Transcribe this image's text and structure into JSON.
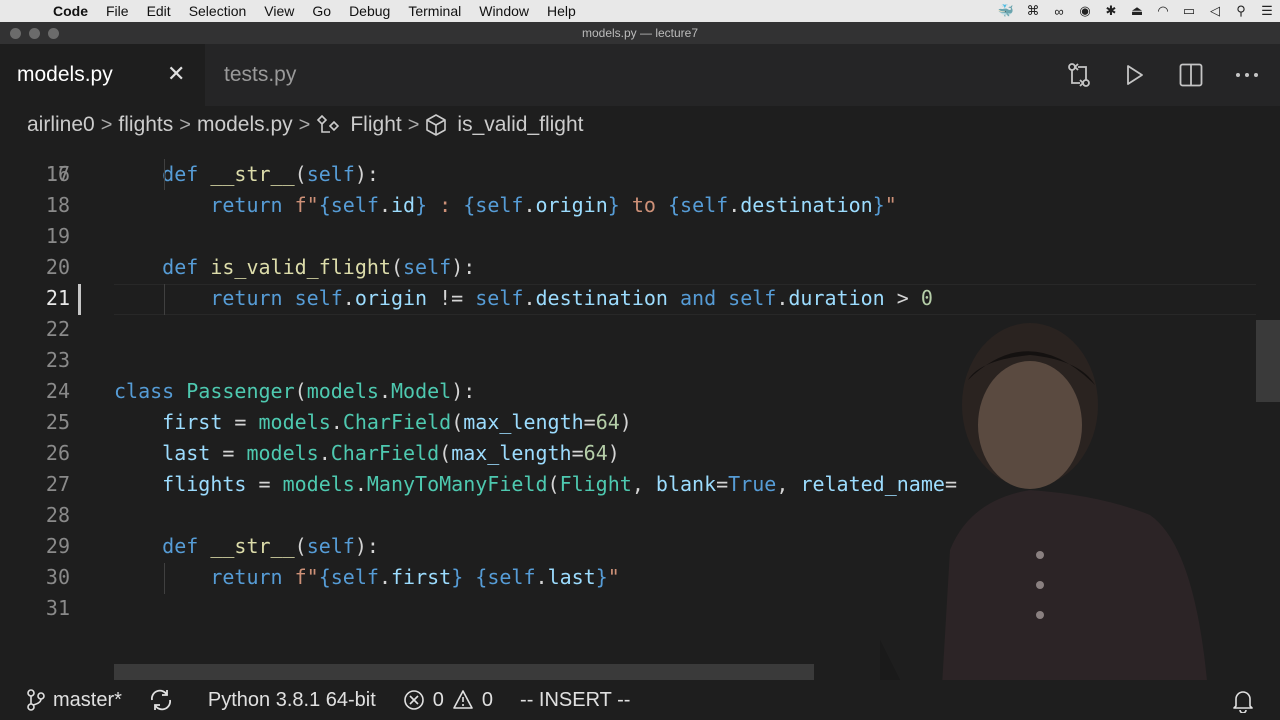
{
  "menubar": {
    "apple_icon": "apple-logo-icon",
    "items": [
      "Code",
      "File",
      "Edit",
      "Selection",
      "View",
      "Go",
      "Debug",
      "Terminal",
      "Window",
      "Help"
    ],
    "tray_icons": [
      "docker-icon",
      "command-icon",
      "glasses-icon",
      "media-icon",
      "bluetooth-icon",
      "eject-icon",
      "wifi-icon",
      "battery-icon",
      "volume-icon",
      "search-icon",
      "list-icon"
    ]
  },
  "window": {
    "title": "models.py — lecture7"
  },
  "tabs": [
    {
      "label": "models.py",
      "active": true,
      "close_label": "✕"
    },
    {
      "label": "tests.py",
      "active": false
    }
  ],
  "editor_actions": [
    "source-control-compare-icon",
    "run-icon",
    "split-editor-icon",
    "more-icon"
  ],
  "breadcrumb": {
    "items": [
      "airline0",
      "flights",
      "models.py",
      "Flight",
      "is_valid_flight"
    ],
    "separator": ">"
  },
  "editor": {
    "partial_top_line": "16",
    "current_line": "21",
    "lines": [
      {
        "n": "17",
        "tokens": [
          [
            "    ",
            ""
          ],
          [
            "def",
            "kw"
          ],
          [
            " ",
            ""
          ],
          [
            "__str__",
            "fn"
          ],
          [
            "(",
            ""
          ],
          [
            "self",
            "self"
          ],
          [
            "):",
            ""
          ]
        ]
      },
      {
        "n": "18",
        "tokens": [
          [
            "        ",
            ""
          ],
          [
            "return",
            "kw"
          ],
          [
            " ",
            ""
          ],
          [
            "f\"",
            "str"
          ],
          [
            "{",
            "kw"
          ],
          [
            "self",
            "self"
          ],
          [
            ".",
            ""
          ],
          [
            "id",
            "attr"
          ],
          [
            "}",
            "kw"
          ],
          [
            " : ",
            "str"
          ],
          [
            "{",
            "kw"
          ],
          [
            "self",
            "self"
          ],
          [
            ".",
            ""
          ],
          [
            "origin",
            "attr"
          ],
          [
            "}",
            "kw"
          ],
          [
            " to ",
            "str"
          ],
          [
            "{",
            "kw"
          ],
          [
            "self",
            "self"
          ],
          [
            ".",
            ""
          ],
          [
            "destination",
            "attr"
          ],
          [
            "}",
            "kw"
          ],
          [
            "\"",
            "str"
          ]
        ]
      },
      {
        "n": "19",
        "tokens": []
      },
      {
        "n": "20",
        "tokens": [
          [
            "    ",
            ""
          ],
          [
            "def",
            "kw"
          ],
          [
            " ",
            ""
          ],
          [
            "is_valid_flight",
            "fn"
          ],
          [
            "(",
            ""
          ],
          [
            "self",
            "self"
          ],
          [
            "):",
            ""
          ]
        ]
      },
      {
        "n": "21",
        "tokens": [
          [
            "        ",
            ""
          ],
          [
            "return",
            "kw"
          ],
          [
            " ",
            ""
          ],
          [
            "self",
            "self"
          ],
          [
            ".",
            ""
          ],
          [
            "origin",
            "attr"
          ],
          [
            " != ",
            ""
          ],
          [
            "self",
            "self"
          ],
          [
            ".",
            ""
          ],
          [
            "destination",
            "attr"
          ],
          [
            " ",
            ""
          ],
          [
            "and",
            "kw"
          ],
          [
            " ",
            ""
          ],
          [
            "self",
            "self"
          ],
          [
            ".",
            ""
          ],
          [
            "duration",
            "attr"
          ],
          [
            " > ",
            ""
          ],
          [
            "0",
            "num"
          ]
        ]
      },
      {
        "n": "22",
        "tokens": []
      },
      {
        "n": "23",
        "tokens": []
      },
      {
        "n": "24",
        "tokens": [
          [
            "class",
            "kw"
          ],
          [
            " ",
            ""
          ],
          [
            "Passenger",
            "cls"
          ],
          [
            "(",
            ""
          ],
          [
            "models",
            "cls"
          ],
          [
            ".",
            ""
          ],
          [
            "Model",
            "cls"
          ],
          [
            "):",
            ""
          ]
        ]
      },
      {
        "n": "25",
        "tokens": [
          [
            "    ",
            ""
          ],
          [
            "first",
            "attr"
          ],
          [
            " = ",
            ""
          ],
          [
            "models",
            "cls"
          ],
          [
            ".",
            ""
          ],
          [
            "CharField",
            "cls"
          ],
          [
            "(",
            ""
          ],
          [
            "max_length",
            "attr"
          ],
          [
            "=",
            ""
          ],
          [
            "64",
            "num"
          ],
          [
            ")",
            ""
          ]
        ]
      },
      {
        "n": "26",
        "tokens": [
          [
            "    ",
            ""
          ],
          [
            "last",
            "attr"
          ],
          [
            " = ",
            ""
          ],
          [
            "models",
            "cls"
          ],
          [
            ".",
            ""
          ],
          [
            "CharField",
            "cls"
          ],
          [
            "(",
            ""
          ],
          [
            "max_length",
            "attr"
          ],
          [
            "=",
            ""
          ],
          [
            "64",
            "num"
          ],
          [
            ")",
            ""
          ]
        ]
      },
      {
        "n": "27",
        "tokens": [
          [
            "    ",
            ""
          ],
          [
            "flights",
            "attr"
          ],
          [
            " = ",
            ""
          ],
          [
            "models",
            "cls"
          ],
          [
            ".",
            ""
          ],
          [
            "ManyToManyField",
            "cls"
          ],
          [
            "(",
            ""
          ],
          [
            "Flight",
            "cls"
          ],
          [
            ", ",
            ""
          ],
          [
            "blank",
            "attr"
          ],
          [
            "=",
            ""
          ],
          [
            "True",
            "kw"
          ],
          [
            ", ",
            ""
          ],
          [
            "related_name",
            "attr"
          ],
          [
            "=",
            ""
          ]
        ]
      },
      {
        "n": "28",
        "tokens": []
      },
      {
        "n": "29",
        "tokens": [
          [
            "    ",
            ""
          ],
          [
            "def",
            "kw"
          ],
          [
            " ",
            ""
          ],
          [
            "__str__",
            "fn"
          ],
          [
            "(",
            ""
          ],
          [
            "self",
            "self"
          ],
          [
            "):",
            ""
          ]
        ]
      },
      {
        "n": "30",
        "tokens": [
          [
            "        ",
            ""
          ],
          [
            "return",
            "kw"
          ],
          [
            " ",
            ""
          ],
          [
            "f\"",
            "str"
          ],
          [
            "{",
            "kw"
          ],
          [
            "self",
            "self"
          ],
          [
            ".",
            ""
          ],
          [
            "first",
            "attr"
          ],
          [
            "}",
            "kw"
          ],
          [
            " ",
            "str"
          ],
          [
            "{",
            "kw"
          ],
          [
            "self",
            "self"
          ],
          [
            ".",
            ""
          ],
          [
            "last",
            "attr"
          ],
          [
            "}",
            "kw"
          ],
          [
            "\"",
            "str"
          ]
        ]
      },
      {
        "n": "31",
        "tokens": []
      }
    ]
  },
  "statusbar": {
    "branch": "master*",
    "sync_icon": "sync-icon",
    "interpreter": "Python 3.8.1 64-bit",
    "errors": "0",
    "warnings": "0",
    "mode": "-- INSERT --",
    "bell_icon": "bell-icon"
  },
  "colors": {
    "editor_bg": "#1e1e1e",
    "keyword": "#569cd6",
    "function": "#dcdcaa",
    "class": "#4ec9b0",
    "string": "#ce9178",
    "number": "#b5cea8",
    "variable": "#9cdcfe"
  }
}
